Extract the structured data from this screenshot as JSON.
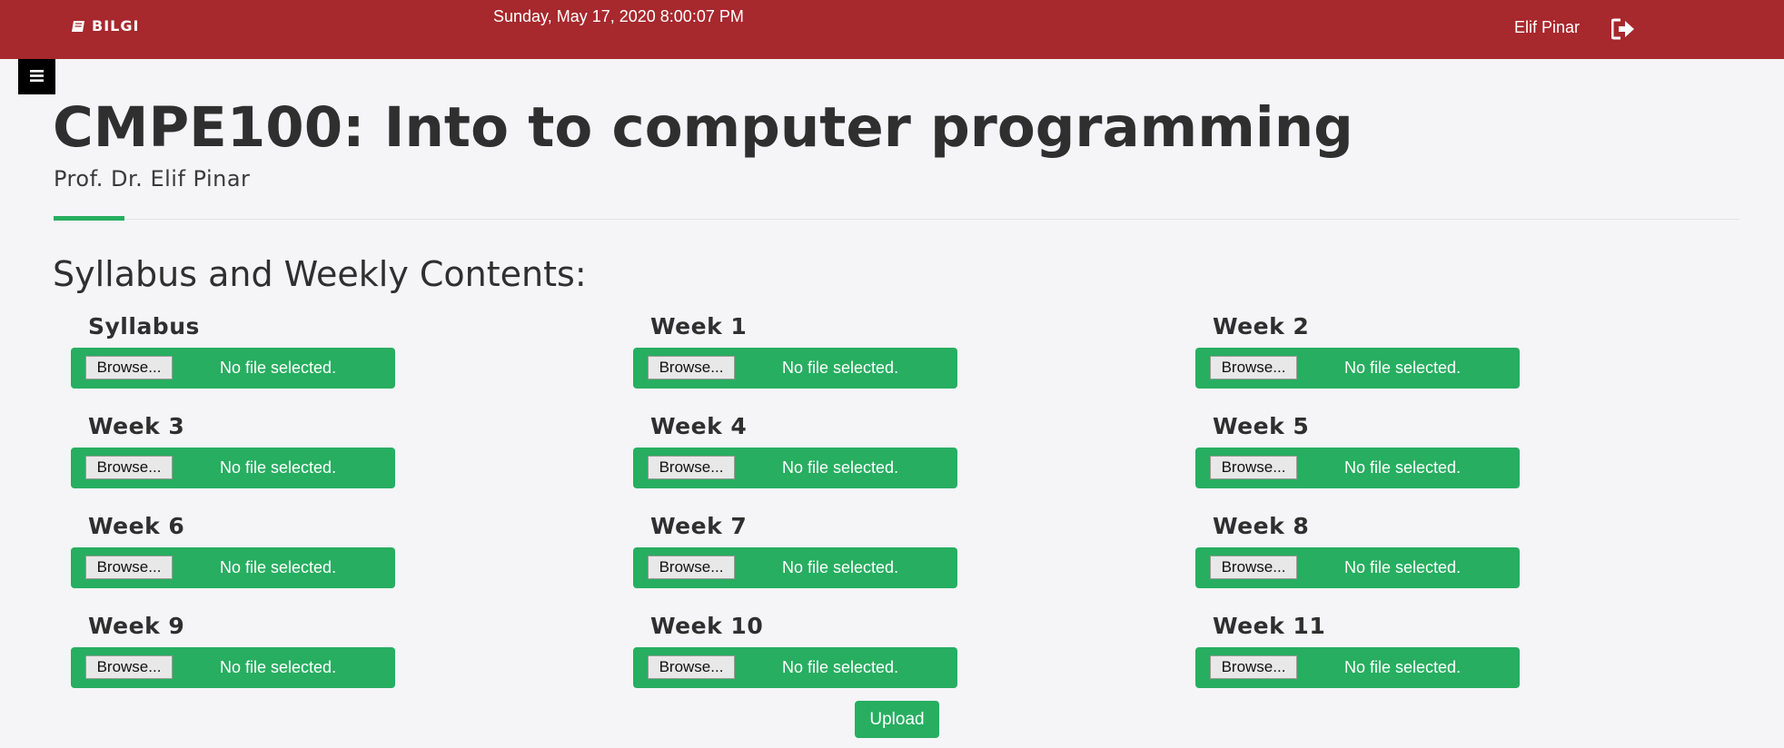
{
  "header": {
    "brand": "BILGI",
    "brand_icon": "book-icon",
    "datetime": "Sunday, May 17, 2020 8:00:07 PM",
    "user_name": "Elif Pinar",
    "logout_icon": "sign-out-icon",
    "background_color": "#a7282d"
  },
  "sidebar_toggle": {
    "icon": "hamburger-menu-icon"
  },
  "course": {
    "title": "CMPE100: Into to computer programming",
    "instructor": "Prof. Dr. Elif Pinar"
  },
  "section": {
    "heading": "Syllabus and Weekly Contents:"
  },
  "uploads": [
    {
      "label": "Syllabus",
      "browse_label": "Browse...",
      "status": "No file selected."
    },
    {
      "label": "Week 1",
      "browse_label": "Browse...",
      "status": "No file selected."
    },
    {
      "label": "Week 2",
      "browse_label": "Browse...",
      "status": "No file selected."
    },
    {
      "label": "Week 3",
      "browse_label": "Browse...",
      "status": "No file selected."
    },
    {
      "label": "Week 4",
      "browse_label": "Browse...",
      "status": "No file selected."
    },
    {
      "label": "Week 5",
      "browse_label": "Browse...",
      "status": "No file selected."
    },
    {
      "label": "Week 6",
      "browse_label": "Browse...",
      "status": "No file selected."
    },
    {
      "label": "Week 7",
      "browse_label": "Browse...",
      "status": "No file selected."
    },
    {
      "label": "Week 8",
      "browse_label": "Browse...",
      "status": "No file selected."
    },
    {
      "label": "Week 9",
      "browse_label": "Browse...",
      "status": "No file selected."
    },
    {
      "label": "Week 10",
      "browse_label": "Browse...",
      "status": "No file selected."
    },
    {
      "label": "Week 11",
      "browse_label": "Browse...",
      "status": "No file selected."
    }
  ],
  "upload_button": {
    "label": "Upload"
  },
  "colors": {
    "accent_green": "#27ae60",
    "header_red": "#a7282d",
    "page_background": "#f5f4f7"
  }
}
